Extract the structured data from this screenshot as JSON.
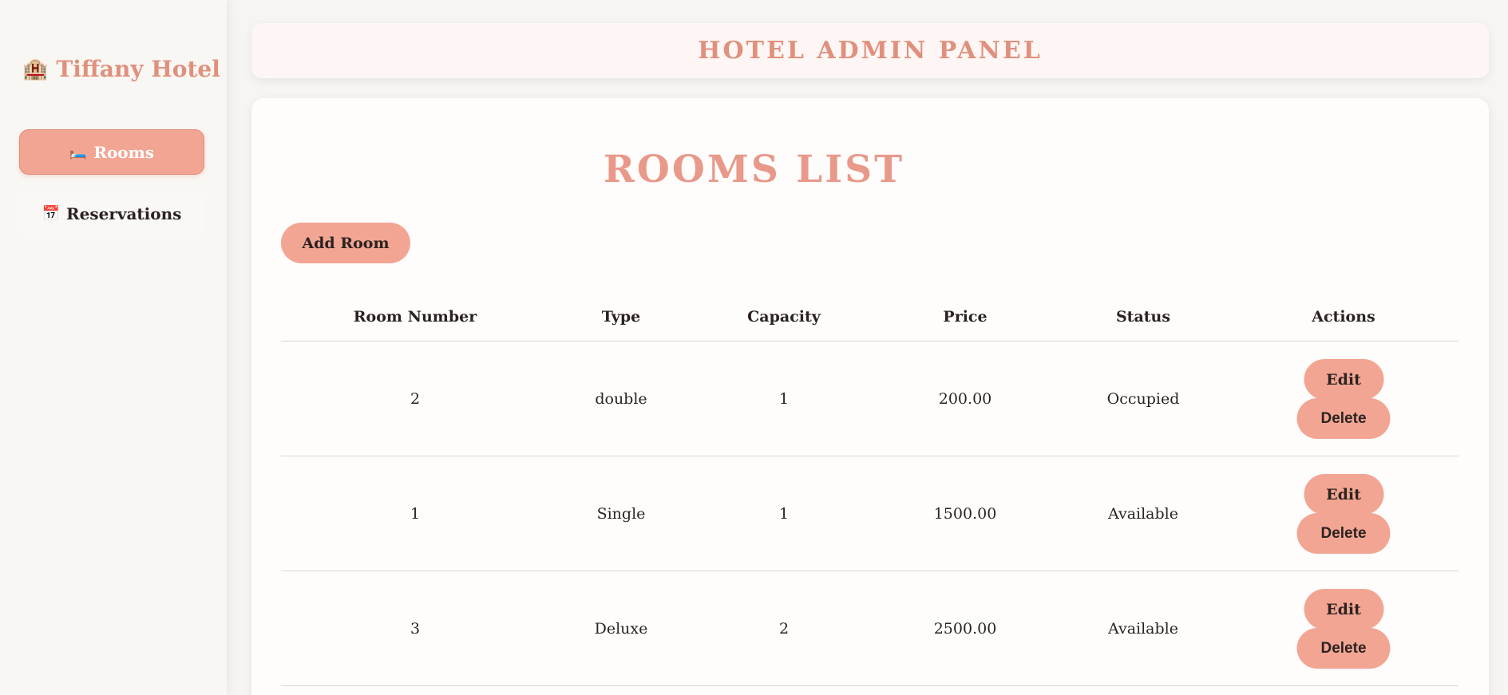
{
  "sidebar": {
    "brand": {
      "icon": "🏨",
      "name": "Tiffany Hotel"
    },
    "items": [
      {
        "icon": "🛏️",
        "label": "Rooms",
        "active": true
      },
      {
        "icon": "📅",
        "label": "Reservations",
        "active": false
      }
    ]
  },
  "header": {
    "title": "HOTEL ADMIN PANEL"
  },
  "main": {
    "title": "ROOMS LIST",
    "add_button": "Add Room",
    "columns": [
      "Room Number",
      "Type",
      "Capacity",
      "Price",
      "Status",
      "Actions"
    ],
    "rows": [
      {
        "number": "2",
        "type": "double",
        "capacity": "1",
        "price": "200.00",
        "status": "Occupied",
        "edit": "Edit",
        "delete": "Delete"
      },
      {
        "number": "1",
        "type": "Single",
        "capacity": "1",
        "price": "1500.00",
        "status": "Available",
        "edit": "Edit",
        "delete": "Delete"
      },
      {
        "number": "3",
        "type": "Deluxe",
        "capacity": "2",
        "price": "2500.00",
        "status": "Available",
        "edit": "Edit",
        "delete": "Delete"
      }
    ]
  },
  "colors": {
    "accent": "#f3a593",
    "brand_text": "#e0907c",
    "title_text": "#e8998a",
    "page_bg": "#f7f5f2"
  }
}
